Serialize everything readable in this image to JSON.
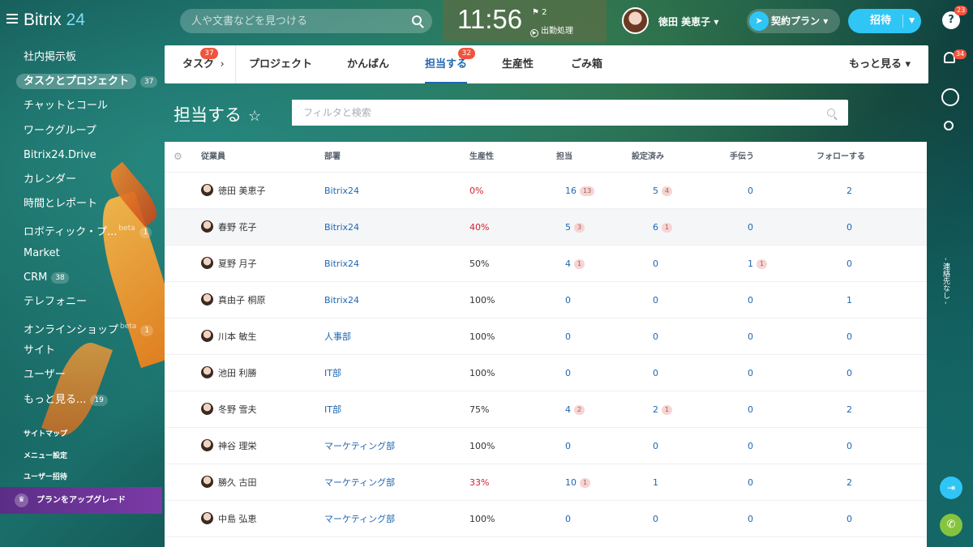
{
  "app": {
    "logo_text": "Bitrix",
    "logo_num": "24"
  },
  "search": {
    "placeholder": "人や文書などを見つける"
  },
  "clock": {
    "time": "11:56",
    "flag_count": "2",
    "checkin_label": "出勤処理"
  },
  "user": {
    "name": "徳田 美恵子"
  },
  "header": {
    "plan_label": "契約プラン",
    "invite_label": "招待",
    "help_label": "?",
    "help_badge": "23"
  },
  "sidebar": {
    "items": [
      {
        "label": "社内掲示板"
      },
      {
        "label": "タスクとプロジェクト",
        "count": "37"
      },
      {
        "label": "チャットとコール"
      },
      {
        "label": "ワークグループ"
      },
      {
        "label": "Bitrix24.Drive"
      },
      {
        "label": "カレンダー"
      },
      {
        "label": "時間とレポート"
      },
      {
        "label": "ロボティック・プ...",
        "beta": "beta",
        "count": "1"
      },
      {
        "label": "Market"
      },
      {
        "label": "CRM",
        "count": "38"
      },
      {
        "label": "テレフォニー"
      },
      {
        "label": "オンラインショップ",
        "beta": "beta",
        "count": "1"
      },
      {
        "label": "サイト"
      },
      {
        "label": "ユーザー"
      },
      {
        "label": "もっと見る...",
        "count": "19"
      }
    ],
    "links": [
      "サイトマップ",
      "メニュー設定",
      "ユーザー招待"
    ],
    "upgrade_label": "プランをアップグレード"
  },
  "tabs": {
    "items": [
      {
        "label": "タスク",
        "count": "37"
      },
      {
        "label": "プロジェクト"
      },
      {
        "label": "かんばん"
      },
      {
        "label": "担当する",
        "count": "32"
      },
      {
        "label": "生産性"
      },
      {
        "label": "ごみ箱"
      }
    ],
    "more_label": "もっと見る"
  },
  "page": {
    "title": "担当する"
  },
  "filter": {
    "placeholder": "フィルタと検索"
  },
  "grid": {
    "columns": [
      "従業員",
      "部署",
      "生産性",
      "担当",
      "設定済み",
      "手伝う",
      "フォローする"
    ],
    "rows": [
      {
        "name": "徳田 美恵子",
        "dept": "Bitrix24",
        "prod": "0%",
        "prod_red": true,
        "assigned": "16",
        "assigned_sub": "13",
        "set": "5",
        "set_sub": "4",
        "help": "0",
        "help_sub": "",
        "follow": "2"
      },
      {
        "name": "春野 花子",
        "dept": "Bitrix24",
        "prod": "40%",
        "prod_red": true,
        "assigned": "5",
        "assigned_sub": "3",
        "set": "6",
        "set_sub": "1",
        "help": "0",
        "help_sub": "",
        "follow": "0"
      },
      {
        "name": "夏野 月子",
        "dept": "Bitrix24",
        "prod": "50%",
        "prod_red": false,
        "assigned": "4",
        "assigned_sub": "1",
        "set": "0",
        "set_sub": "",
        "help": "1",
        "help_sub": "1",
        "follow": "0"
      },
      {
        "name": "真由子 桐原",
        "dept": "Bitrix24",
        "prod": "100%",
        "prod_red": false,
        "assigned": "0",
        "assigned_sub": "",
        "set": "0",
        "set_sub": "",
        "help": "0",
        "help_sub": "",
        "follow": "1"
      },
      {
        "name": "川本 敏生",
        "dept": "人事部",
        "prod": "100%",
        "prod_red": false,
        "assigned": "0",
        "assigned_sub": "",
        "set": "0",
        "set_sub": "",
        "help": "0",
        "help_sub": "",
        "follow": "0"
      },
      {
        "name": "池田 利勝",
        "dept": "IT部",
        "prod": "100%",
        "prod_red": false,
        "assigned": "0",
        "assigned_sub": "",
        "set": "0",
        "set_sub": "",
        "help": "0",
        "help_sub": "",
        "follow": "0"
      },
      {
        "name": "冬野 雪夫",
        "dept": "IT部",
        "prod": "75%",
        "prod_red": false,
        "assigned": "4",
        "assigned_sub": "2",
        "set": "2",
        "set_sub": "1",
        "help": "0",
        "help_sub": "",
        "follow": "2"
      },
      {
        "name": "神谷 理栄",
        "dept": "マーケティング部",
        "prod": "100%",
        "prod_red": false,
        "assigned": "0",
        "assigned_sub": "",
        "set": "0",
        "set_sub": "",
        "help": "0",
        "help_sub": "",
        "follow": "0"
      },
      {
        "name": "勝久 古田",
        "dept": "マーケティング部",
        "prod": "33%",
        "prod_red": true,
        "assigned": "10",
        "assigned_sub": "1",
        "set": "1",
        "set_sub": "",
        "help": "0",
        "help_sub": "",
        "follow": "2"
      },
      {
        "name": "中島 弘恵",
        "dept": "マーケティング部",
        "prod": "100%",
        "prod_red": false,
        "assigned": "0",
        "assigned_sub": "",
        "set": "0",
        "set_sub": "",
        "help": "0",
        "help_sub": "",
        "follow": "0"
      }
    ]
  },
  "rail": {
    "notif_badge": "34",
    "label": "- 連絡先なし -"
  },
  "icons": {
    "search": "search-icon",
    "bell": "bell-icon",
    "chat": "chat-icon",
    "exit": "exit-icon",
    "phone": "phone-icon",
    "gear": "gear-icon",
    "star": "star-icon",
    "rocket": "rocket-icon",
    "crown": "crown-icon"
  }
}
